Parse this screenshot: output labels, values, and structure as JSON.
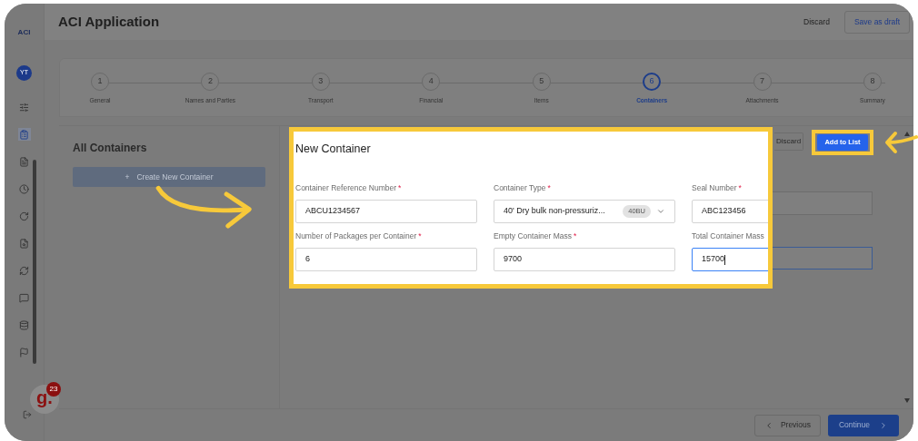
{
  "sidebar": {
    "logo": "ACI",
    "avatar": "YT"
  },
  "header": {
    "title": "ACI Application",
    "discard": "Discard",
    "save": "Save as draft"
  },
  "steps": [
    {
      "number": "1",
      "label": "General",
      "selected": false
    },
    {
      "number": "2",
      "label": "Names and Parties",
      "selected": false
    },
    {
      "number": "3",
      "label": "Transport",
      "selected": false
    },
    {
      "number": "4",
      "label": "Financial",
      "selected": false
    },
    {
      "number": "5",
      "label": "Items",
      "selected": false
    },
    {
      "number": "6",
      "label": "Containers",
      "selected": true
    },
    {
      "number": "7",
      "label": "Attachments",
      "selected": false
    },
    {
      "number": "8",
      "label": "Summary",
      "selected": false
    }
  ],
  "left_panel": {
    "title": "All Containers",
    "create_icon": "+",
    "create_button": "Create New Container"
  },
  "form": {
    "title": "New Container",
    "discard": "Discard",
    "add": "Add to List",
    "fields": [
      {
        "kind": "text",
        "label": "Container Reference Number",
        "mark": "*",
        "value": "ABCU1234567",
        "focused": false
      },
      {
        "kind": "select",
        "label": "Container Type",
        "mark": "*",
        "value": "40' Dry bulk non-pressuriz...",
        "tag": "40BU",
        "focused": false
      },
      {
        "kind": "text",
        "label": "Seal Number",
        "mark": "*",
        "value": "ABC123456",
        "focused": false
      },
      {
        "kind": "text",
        "label": "Number of Packages per Container",
        "mark": "*",
        "value": "6",
        "focused": false
      },
      {
        "kind": "text",
        "label": "Empty Container Mass",
        "mark": "*",
        "value": "9700",
        "focused": false
      },
      {
        "kind": "text",
        "label": "Total Container Mass",
        "value": "15700",
        "focused": true
      }
    ]
  },
  "footer": {
    "previous": "Previous",
    "continue": "Continue"
  },
  "help_badge": {
    "logo": "g.",
    "count": "23"
  }
}
